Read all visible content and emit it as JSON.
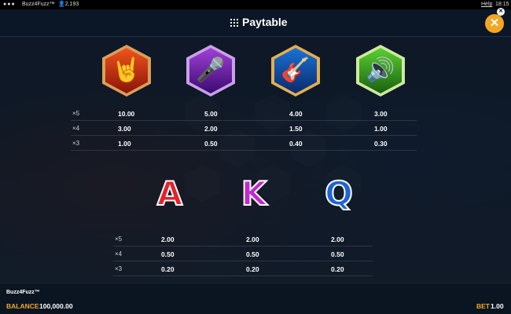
{
  "status_bar": {
    "app_name": "Buzz4Fuzz™",
    "user_count": "2,193",
    "help": "Help",
    "clock": "18:15"
  },
  "header": {
    "title": "Paytable",
    "close": "✕"
  },
  "colors": {
    "accent": "#f5a623",
    "header_bg": "#0b1726"
  },
  "premium_symbols": [
    {
      "name": "rock-hand",
      "icon": "🤘",
      "pays": [
        "10.00",
        "3.00",
        "1.00"
      ]
    },
    {
      "name": "microphone",
      "icon": "🎤",
      "pays": [
        "5.00",
        "2.00",
        "0.50"
      ]
    },
    {
      "name": "guitar",
      "icon": "🎸",
      "pays": [
        "4.00",
        "1.50",
        "0.40"
      ]
    },
    {
      "name": "speaker",
      "icon": "🔊",
      "pays": [
        "3.00",
        "1.00",
        "0.30"
      ]
    }
  ],
  "premium_multipliers": [
    "×5",
    "×4",
    "×3"
  ],
  "low_symbols": [
    {
      "letter": "A",
      "color": "#e8202a",
      "pays": [
        "2.00",
        "0.50",
        "0.20"
      ]
    },
    {
      "letter": "K",
      "color": "#c02ad0",
      "pays": [
        "2.00",
        "0.50",
        "0.20"
      ]
    },
    {
      "letter": "Q",
      "color": "#1f63d8",
      "pays": [
        "2.00",
        "0.50",
        "0.20"
      ]
    }
  ],
  "low_multipliers": [
    "×5",
    "×4",
    "×3"
  ],
  "footer": {
    "game_name": "Buzz4Fuzz™",
    "balance_label": "BALANCE",
    "balance_value": "100,000.00",
    "bet_label": "BET",
    "bet_value": "1.00"
  }
}
